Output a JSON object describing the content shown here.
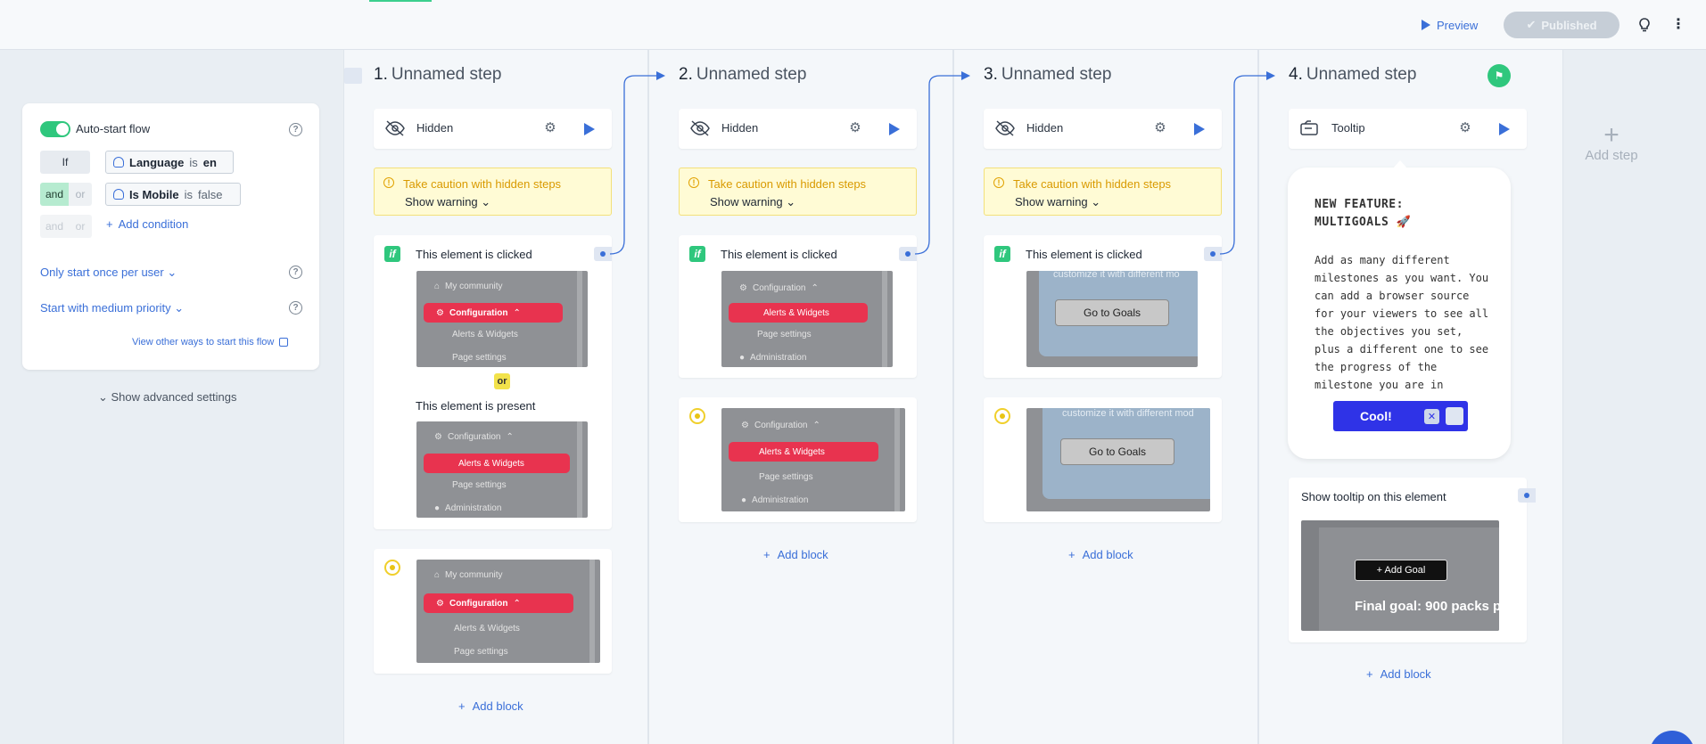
{
  "topbar": {
    "preview_label": "Preview",
    "published_label": "Published"
  },
  "trigger": {
    "autostart_label": "Auto-start flow",
    "if_label": "If",
    "and_label": "and",
    "or_label": "or",
    "cond1": {
      "attr": "Language",
      "op": "is",
      "value": "en"
    },
    "cond2": {
      "attr": "Is Mobile",
      "op": "is",
      "value": "false"
    },
    "add_condition_label": "Add condition",
    "frequency_label": "Only start once per user",
    "priority_label": "Start with medium priority",
    "other_ways_label": "View other ways to start this flow",
    "advanced_label": "Show advanced settings"
  },
  "steps": [
    {
      "num": "1.",
      "name": "Unnamed step",
      "type": "Hidden"
    },
    {
      "num": "2.",
      "name": "Unnamed step",
      "type": "Hidden"
    },
    {
      "num": "3.",
      "name": "Unnamed step",
      "type": "Hidden"
    },
    {
      "num": "4.",
      "name": "Unnamed step",
      "type": "Tooltip"
    }
  ],
  "warning": {
    "title": "Take caution with hidden steps",
    "toggle": "Show warning"
  },
  "blocks": {
    "clicked": "This element is clicked",
    "present": "This element is present",
    "or_label": "or",
    "show_tooltip_on": "Show tooltip on this element",
    "add_block": "Add block"
  },
  "thumbs": {
    "my_community": "My community",
    "configuration": "Configuration",
    "alerts_widgets": "Alerts & Widgets",
    "page_settings": "Page settings",
    "administration": "Administration",
    "customize": "customize it with different mo",
    "customize2": "customize it with different mod",
    "go_to_goals": "Go to Goals",
    "add_goal": "+ Add Goal",
    "final_goal": "Final goal: 900 packs p"
  },
  "tooltip": {
    "title": "NEW FEATURE: MULTIGOALS 🚀",
    "body": "Add as many different milestones as you want. You can add a browser source for your viewers to see all the objectives you set, plus a different one to see the progress of the milestone you are in",
    "button": "Cool!"
  },
  "add_step_label": "Add step",
  "colors": {
    "accent": "#3a6fd8",
    "green": "#2fc77d",
    "warning": "#d99a00",
    "tooltip_button": "#2f33e7"
  }
}
